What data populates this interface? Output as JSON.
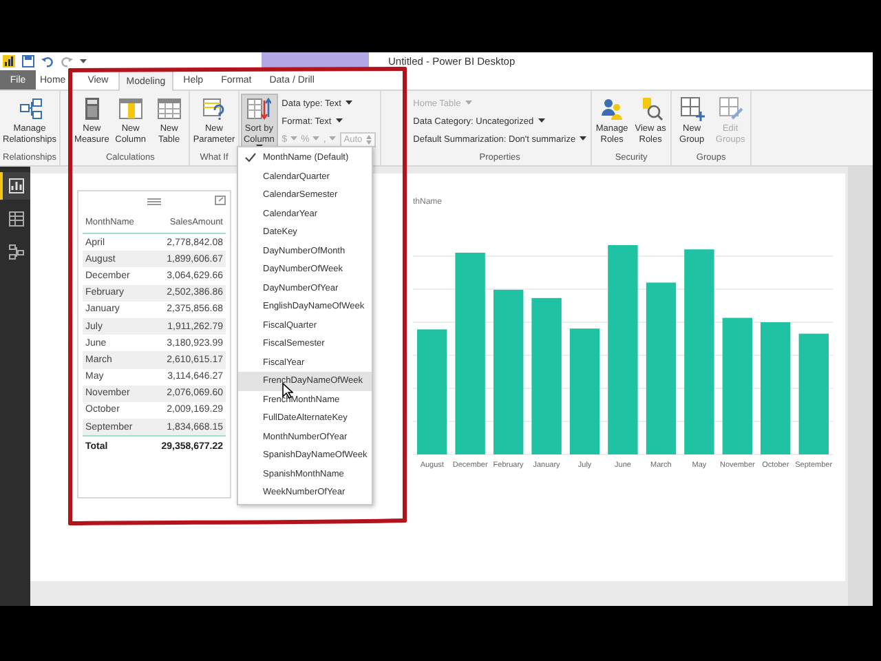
{
  "window": {
    "title": "Untitled - Power BI Desktop"
  },
  "tabs": [
    {
      "label": "File",
      "kind": "file",
      "selected": false
    },
    {
      "label": "Home",
      "kind": "tab",
      "selected": false
    },
    {
      "label": "View",
      "kind": "tab",
      "selected": false
    },
    {
      "label": "Modeling",
      "kind": "tab",
      "selected": true
    },
    {
      "label": "Help",
      "kind": "tab",
      "selected": false
    },
    {
      "label": "Format",
      "kind": "tab",
      "selected": false
    },
    {
      "label": "Data / Drill",
      "kind": "tab",
      "selected": false
    }
  ],
  "ribbon": {
    "groups": [
      {
        "label": "Relationships",
        "items": [
          {
            "kind": "large",
            "label": "Manage Relationships",
            "disabled": false,
            "menu": false,
            "expanded": false
          }
        ]
      },
      {
        "label": "Calculations",
        "items": [
          {
            "kind": "large",
            "label": "New Measure",
            "disabled": false,
            "menu": false,
            "expanded": false
          },
          {
            "kind": "large",
            "label": "New Column",
            "disabled": false,
            "menu": false,
            "expanded": false
          },
          {
            "kind": "large",
            "label": "New Table",
            "disabled": false,
            "menu": false,
            "expanded": false
          }
        ]
      },
      {
        "label": "What If",
        "items": [
          {
            "kind": "large",
            "label": "New Parameter",
            "disabled": false,
            "menu": false,
            "expanded": false
          }
        ]
      },
      {
        "items": [
          {
            "kind": "large",
            "label": "Sort by Column",
            "disabled": false,
            "menu": true,
            "expanded": true
          },
          {
            "kind": "fields",
            "rows": [
              {
                "kind": "field",
                "label": "Data type: Text",
                "disabled": false,
                "menu": true
              },
              {
                "kind": "field",
                "label": "Format: Text",
                "disabled": false,
                "menu": true
              },
              {
                "kind": "number_format",
                "symbols": [
                  "$",
                  "%",
                  ","
                ],
                "value": "Auto",
                "disabled": true
              }
            ]
          }
        ]
      },
      {
        "label": "Properties",
        "items": [
          {
            "kind": "fields",
            "rows": [
              {
                "kind": "field",
                "label": "Home Table",
                "disabled": true,
                "menu": true
              },
              {
                "kind": "field",
                "label": "Data Category: Uncategorized",
                "disabled": false,
                "menu": true
              },
              {
                "kind": "field",
                "label": "Default Summarization: Don't summarize",
                "disabled": false,
                "menu": true
              }
            ]
          }
        ]
      },
      {
        "label": "Security",
        "items": [
          {
            "kind": "large",
            "label": "Manage Roles",
            "disabled": false,
            "menu": false,
            "expanded": false
          },
          {
            "kind": "large",
            "label": "View as Roles",
            "disabled": false,
            "menu": false,
            "expanded": false
          }
        ]
      },
      {
        "label": "Groups",
        "items": [
          {
            "kind": "large",
            "label": "New Group",
            "disabled": false,
            "menu": false,
            "expanded": false
          },
          {
            "kind": "large",
            "label": "Edit Groups",
            "disabled": true,
            "menu": false,
            "expanded": false
          }
        ]
      }
    ]
  },
  "nav": [
    {
      "kind": "report",
      "selected": true
    },
    {
      "kind": "data",
      "selected": false
    },
    {
      "kind": "model",
      "selected": false
    }
  ],
  "table": {
    "columns": [
      "MonthName",
      "SalesAmount"
    ],
    "rows": [
      {
        "month": "April",
        "amount": "2,778,842.08"
      },
      {
        "month": "August",
        "amount": "1,899,606.67"
      },
      {
        "month": "December",
        "amount": "3,064,629.66"
      },
      {
        "month": "February",
        "amount": "2,502,386.86"
      },
      {
        "month": "January",
        "amount": "2,375,856.68"
      },
      {
        "month": "July",
        "amount": "1,911,262.79"
      },
      {
        "month": "June",
        "amount": "3,180,923.99"
      },
      {
        "month": "March",
        "amount": "2,610,615.17"
      },
      {
        "month": "May",
        "amount": "3,114,646.27"
      },
      {
        "month": "November",
        "amount": "2,076,069.60"
      },
      {
        "month": "October",
        "amount": "2,009,169.29"
      },
      {
        "month": "September",
        "amount": "1,834,668.15"
      }
    ],
    "total": {
      "label": "Total",
      "value": "29,358,677.22"
    }
  },
  "chart": {
    "axis_title": "thName",
    "x_labels": [
      "August",
      "December",
      "February",
      "January",
      "July",
      "June",
      "March",
      "May",
      "November",
      "October",
      "September"
    ]
  },
  "sort_menu": {
    "items": [
      {
        "label": "MonthName (Default)",
        "checked": true,
        "hovered": false
      },
      {
        "label": "CalendarQuarter",
        "checked": false,
        "hovered": false
      },
      {
        "label": "CalendarSemester",
        "checked": false,
        "hovered": false
      },
      {
        "label": "CalendarYear",
        "checked": false,
        "hovered": false
      },
      {
        "label": "DateKey",
        "checked": false,
        "hovered": false
      },
      {
        "label": "DayNumberOfMonth",
        "checked": false,
        "hovered": false
      },
      {
        "label": "DayNumberOfWeek",
        "checked": false,
        "hovered": false
      },
      {
        "label": "DayNumberOfYear",
        "checked": false,
        "hovered": false
      },
      {
        "label": "EnglishDayNameOfWeek",
        "checked": false,
        "hovered": false
      },
      {
        "label": "FiscalQuarter",
        "checked": false,
        "hovered": false
      },
      {
        "label": "FiscalSemester",
        "checked": false,
        "hovered": false
      },
      {
        "label": "FiscalYear",
        "checked": false,
        "hovered": false
      },
      {
        "label": "FrenchDayNameOfWeek",
        "checked": false,
        "hovered": true
      },
      {
        "label": "FrenchMonthName",
        "checked": false,
        "hovered": false
      },
      {
        "label": "FullDateAlternateKey",
        "checked": false,
        "hovered": false
      },
      {
        "label": "MonthNumberOfYear",
        "checked": false,
        "hovered": false
      },
      {
        "label": "SpanishDayNameOfWeek",
        "checked": false,
        "hovered": false
      },
      {
        "label": "SpanishMonthName",
        "checked": false,
        "hovered": false
      },
      {
        "label": "WeekNumberOfYear",
        "checked": false,
        "hovered": false
      }
    ]
  }
}
